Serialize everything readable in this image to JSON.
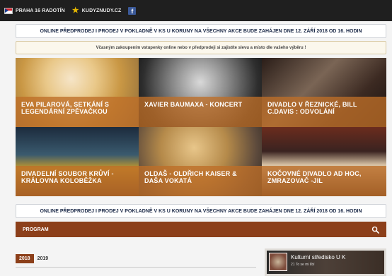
{
  "topbar": {
    "praha_label": "PRAHA 16 RADOTÍN",
    "kudyznudy_label": "KUDYZNUDY.CZ",
    "facebook_glyph": "f"
  },
  "notices": {
    "presale_line": "ONLINE PŘEDPRODEJ I PRODEJ V POKLADNĚ V KS U KORUNY NA VŠECHNY AKCE BUDE ZAHÁJEN DNE 12. ZÁŘÍ 2018 OD 16. HODIN",
    "advice_line": "Včasným zakoupením vstupenky online nebo v předprodeji si zajistíte slevu a místo dle vašeho výběru !"
  },
  "events": [
    {
      "title": "EVA PILAROVÁ, SETKÁNÍ S LEGENDÁRNÍ ZPĚVAČKOU"
    },
    {
      "title": "XAVIER BAUMAXA - KONCERT"
    },
    {
      "title": "DIVADLO V ŘEZNICKÉ, BILL C.DAVIS : ODVOLÁNÍ"
    },
    {
      "title": "DIVADELNÍ SOUBOR KRŮVÍ - KRÁLOVNA KOLOBĚŽKA"
    },
    {
      "title": "OLDAŠ - OLDŘICH KAISER & DAŠA VOKATÁ"
    },
    {
      "title": "KOČOVNÉ DIVADLO AD HOC, ZMRAZOVAČ -JIL"
    }
  ],
  "program": {
    "label": "PROGRAM"
  },
  "years": {
    "active": "2018",
    "other": "2019"
  },
  "facebook_widget": {
    "title": "Kulturní středisko U K",
    "subtitle": "21 To se mi líbí"
  },
  "colors": {
    "accent": "#8c3f1a",
    "caption_overlay": "#be6e28",
    "topbar": "#1f1f1f"
  }
}
